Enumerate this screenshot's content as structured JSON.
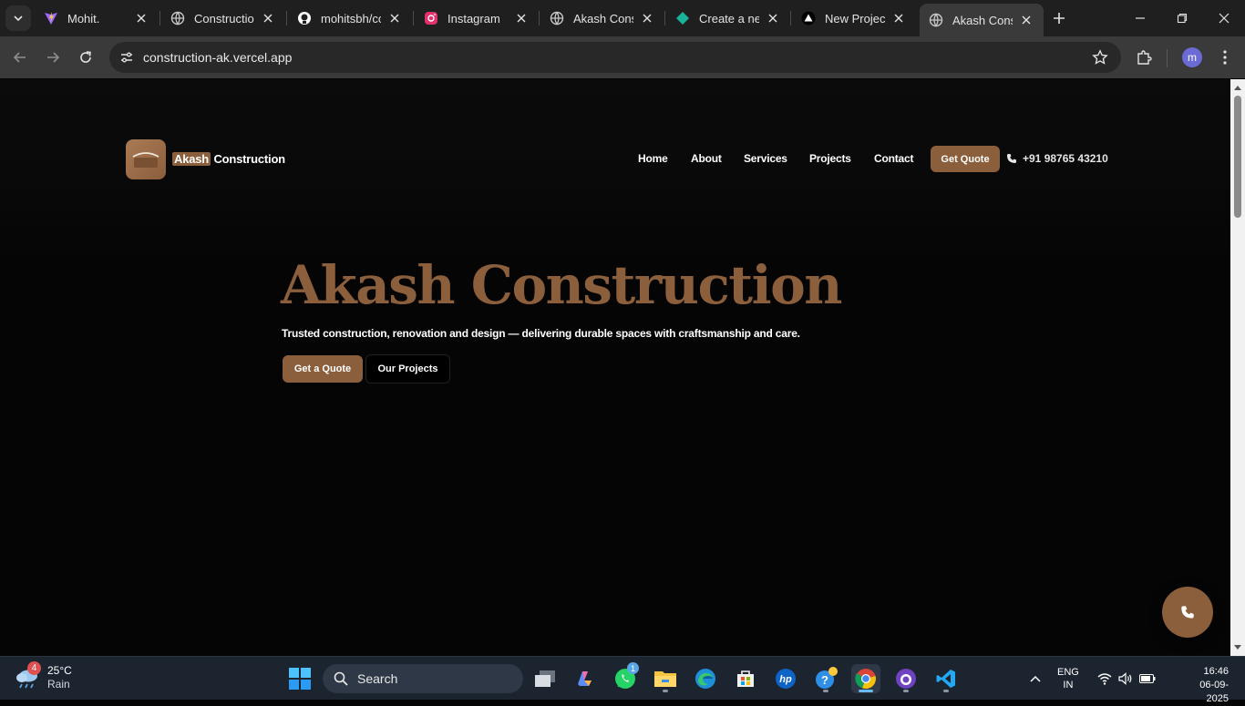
{
  "browser": {
    "tabs": [
      {
        "title": "Mohit.",
        "icon": "vite-icon",
        "color": "#9b6bff"
      },
      {
        "title": "Construction",
        "icon": "globe-icon",
        "color": "#c8c8c8"
      },
      {
        "title": "mohitsbh/co",
        "icon": "github-icon",
        "color": "#ffffff"
      },
      {
        "title": "Instagram",
        "icon": "instagram-icon",
        "color": "#e1306c"
      },
      {
        "title": "Akash Const",
        "icon": "globe-icon",
        "color": "#c8c8c8"
      },
      {
        "title": "Create a new",
        "icon": "diamond-icon",
        "color": "#19b39a"
      },
      {
        "title": "New Project",
        "icon": "vercel-icon",
        "color": "#ffffff"
      },
      {
        "title": "Akash Const",
        "icon": "globe-icon",
        "color": "#c8c8c8",
        "active": true
      }
    ],
    "url": "construction-ak.vercel.app",
    "profile_initial": "m"
  },
  "site": {
    "brand_highlight": "Akash",
    "brand_rest": " Construction",
    "nav": {
      "home": "Home",
      "about": "About",
      "services": "Services",
      "projects": "Projects",
      "contact": "Contact"
    },
    "quote_button": "Get Quote",
    "phone": "+91 98765 43210",
    "accent_color": "#8b5e3c",
    "hero": {
      "title": "Akash Construction",
      "subtitle": "Trusted construction, renovation and design — delivering durable spaces with craftsmanship and care.",
      "primary_cta": "Get a Quote",
      "secondary_cta": "Our Projects"
    }
  },
  "taskbar": {
    "weather_temp": "25°C",
    "weather_condition": "Rain",
    "weather_badge": "4",
    "search_placeholder": "Search",
    "whatsapp_badge": "1",
    "lang_top": "ENG",
    "lang_bottom": "IN",
    "time": "16:46",
    "date": "06-09-2025"
  }
}
